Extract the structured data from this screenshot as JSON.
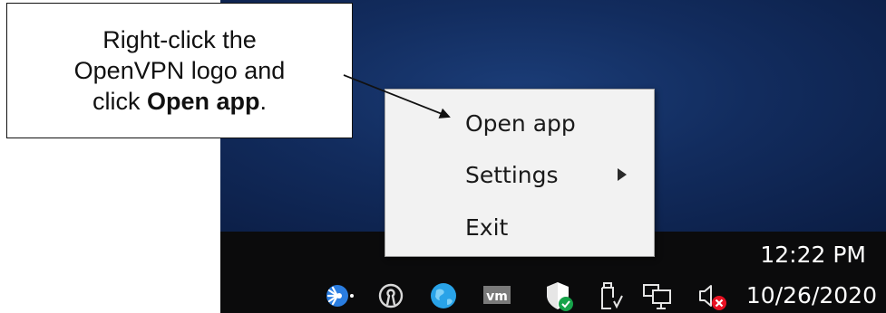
{
  "callout": {
    "line1": "Right-click the",
    "line2": "OpenVPN logo and",
    "line3_prefix": "click ",
    "line3_bold": "Open app",
    "line3_suffix": "."
  },
  "context_menu": {
    "items": [
      {
        "label": "Open app"
      },
      {
        "label": "Settings",
        "has_submenu": true
      },
      {
        "label": "Exit"
      }
    ]
  },
  "tray": {
    "icons": [
      "network-satellite-icon",
      "openvpn-icon",
      "globe-icon",
      "vmware-icon",
      "defender-shield-icon",
      "usb-eject-icon",
      "network-computer-icon",
      "volume-muted-icon"
    ]
  },
  "clock": {
    "time": "12:22 PM",
    "date": "10/26/2020"
  },
  "colors": {
    "desktop": "#122c5e",
    "taskbar": "#0b0b0c",
    "menu_bg": "#f2f2f2",
    "muted_badge": "#e81123",
    "defender_badge": "#16a34a"
  }
}
